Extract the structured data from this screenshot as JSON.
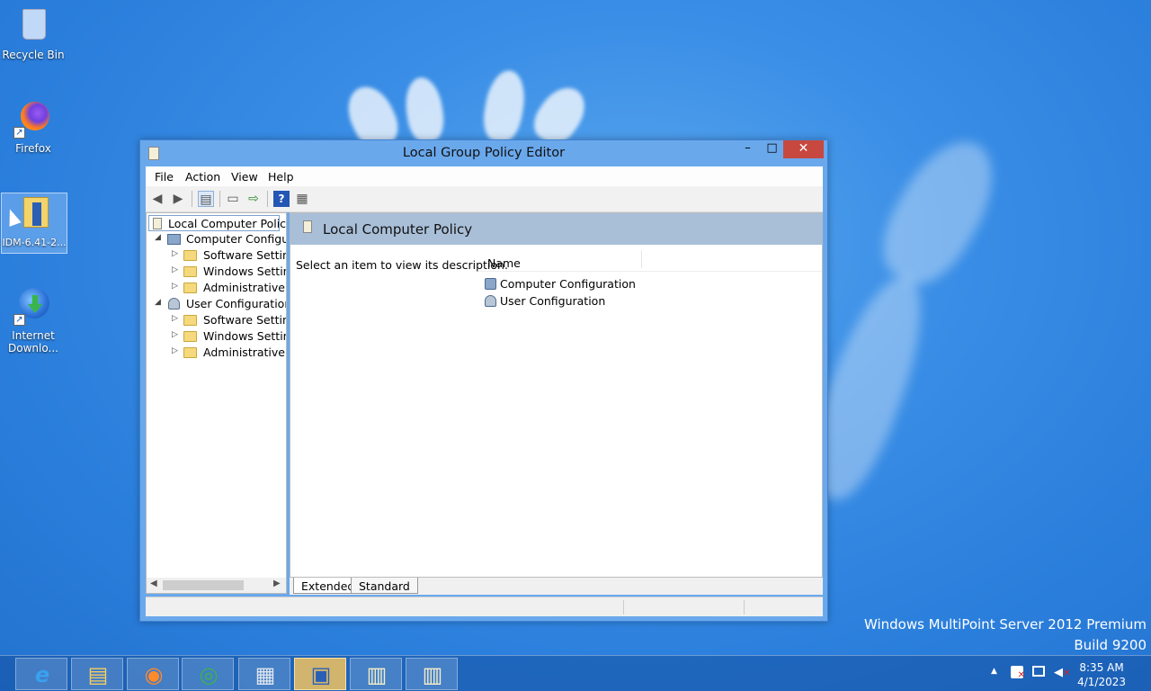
{
  "desktop": {
    "icons": [
      {
        "label": "Recycle Bin"
      },
      {
        "label": "Firefox"
      },
      {
        "label": "IDM-6.41-2..."
      },
      {
        "label": "Internet Downlo..."
      }
    ],
    "watermark": {
      "line1": "Windows MultiPoint Server 2012 Premium",
      "line2": "Build 9200"
    }
  },
  "window": {
    "title": "Local Group Policy Editor",
    "controls": {
      "minimize": "–",
      "maximize": "□",
      "close": "✕"
    },
    "menu": [
      "File",
      "Action",
      "View",
      "Help"
    ],
    "tree": {
      "root": "Local Computer Policy",
      "items": [
        {
          "label": "Computer Configura",
          "level": 1,
          "arrow": "◢"
        },
        {
          "label": "Software Settings",
          "level": 2,
          "arrow": "▷"
        },
        {
          "label": "Windows Setting",
          "level": 2,
          "arrow": "▷"
        },
        {
          "label": "Administrative Te",
          "level": 2,
          "arrow": "▷"
        },
        {
          "label": "User Configuration",
          "level": 1,
          "arrow": "◢"
        },
        {
          "label": "Software Settings",
          "level": 2,
          "arrow": "▷"
        },
        {
          "label": "Windows Setting",
          "level": 2,
          "arrow": "▷"
        },
        {
          "label": "Administrative Te",
          "level": 2,
          "arrow": "▷"
        }
      ]
    },
    "details": {
      "header": "Local Computer Policy",
      "description": "Select an item to view its description.",
      "column_name": "Name",
      "items": [
        "Computer Configuration",
        "User Configuration"
      ]
    },
    "tabs": [
      "Extended",
      "Standard"
    ],
    "active_tab": "Extended"
  },
  "taskbar": {
    "apps": [
      {
        "name": "internet-explorer-icon",
        "glyph": "e"
      },
      {
        "name": "file-explorer-icon",
        "glyph": "▤"
      },
      {
        "name": "firefox-icon",
        "glyph": "◉"
      },
      {
        "name": "internet-download-manager-icon",
        "glyph": "◎"
      },
      {
        "name": "server-manager-icon",
        "glyph": "▦"
      },
      {
        "name": "group-policy-icon",
        "glyph": "▣",
        "active": true
      },
      {
        "name": "notepad-icon",
        "glyph": "▥"
      },
      {
        "name": "notepad-icon-2",
        "glyph": "▥"
      }
    ],
    "tray": {
      "time": "8:35 AM",
      "date": "4/1/2023"
    }
  }
}
